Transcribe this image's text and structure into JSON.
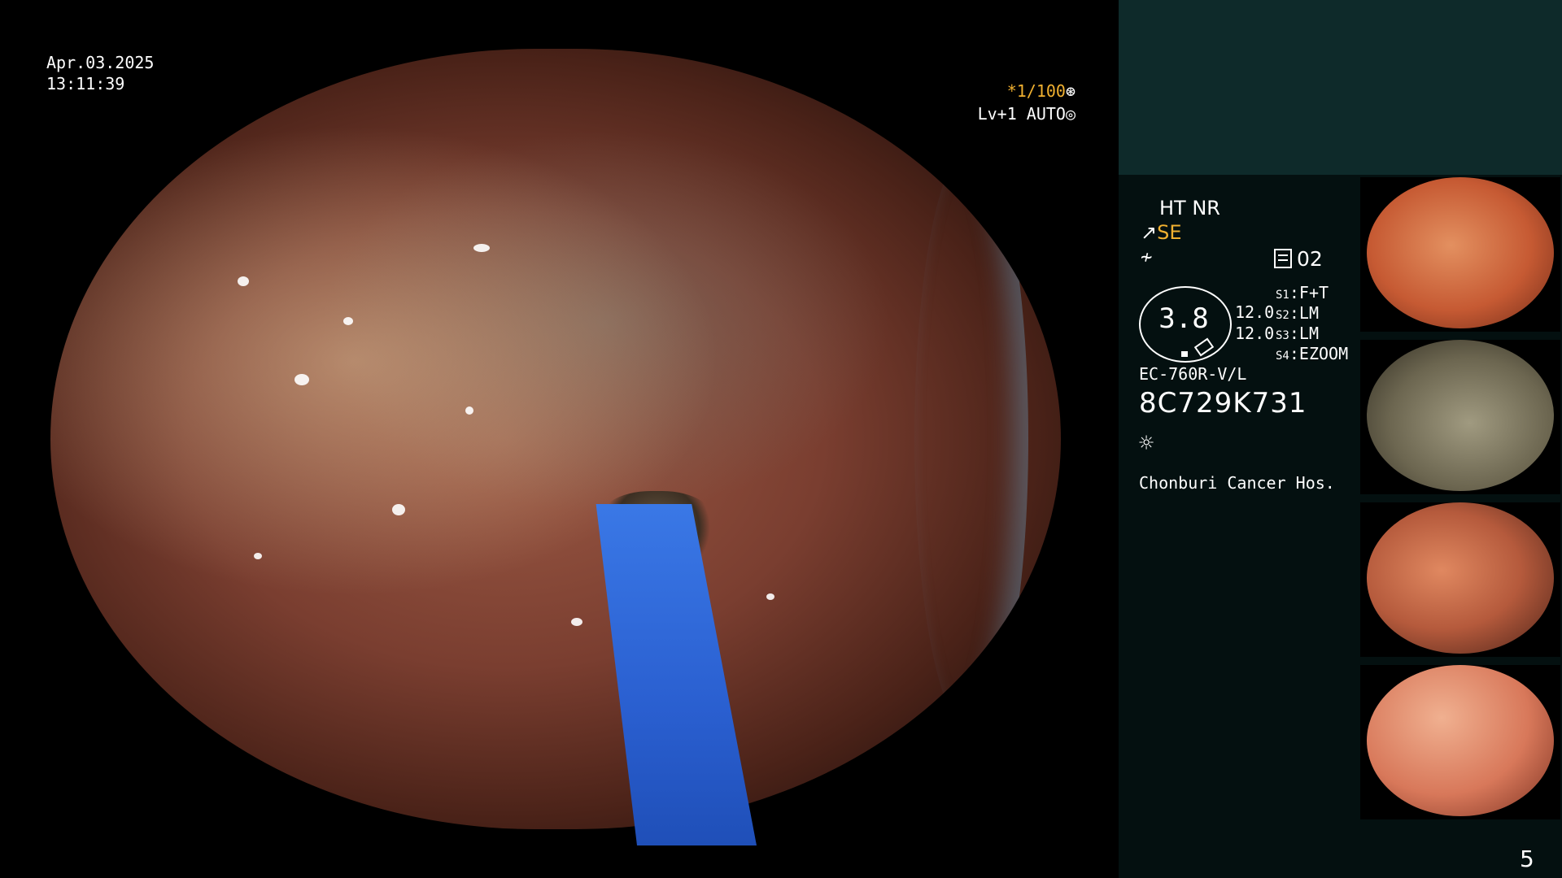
{
  "overlay": {
    "date": "Apr.03.2025",
    "time": "13:11:39",
    "shutter_value": "*1/100",
    "level_text": "Lv+1 AUTO"
  },
  "panel": {
    "ht_nr": "HT NR",
    "se_label": "SE",
    "memo_count": "02",
    "gauge_value": "3.8",
    "value_1": "12.0",
    "value_2": "12.0",
    "settings": [
      {
        "key": "S1",
        "value": "F+T"
      },
      {
        "key": "S2",
        "value": "LM"
      },
      {
        "key": "S3",
        "value": "LM"
      },
      {
        "key": "S4",
        "value": "EZOOM"
      }
    ],
    "scope_model": "EC-760R-V/L",
    "scope_serial": "8C729K731",
    "hospital": "Chonburi Cancer Hos."
  },
  "icons": {
    "shutter": "aperture-icon",
    "level": "auto-iris-icon",
    "se": "structure-enhance-icon",
    "freeze": "freeze-icon",
    "memo": "memo-icon",
    "light": "sun-icon"
  },
  "page_number": "5"
}
